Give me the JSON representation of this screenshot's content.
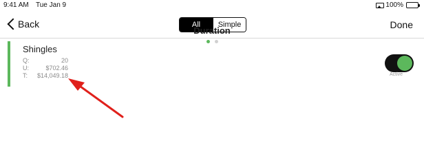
{
  "status_bar": {
    "time": "9:41 AM",
    "date": "Tue Jan 9",
    "battery_percent": "100%",
    "battery_level": 1.0,
    "battery_color": "#34c759"
  },
  "nav": {
    "back_label": "Back",
    "segments": [
      "All",
      "Simple"
    ],
    "selected_segment": "All",
    "done_label": "Done"
  },
  "item": {
    "title": "Shingles",
    "accent_color": "#5cb85c",
    "stats": [
      {
        "label": "Q:",
        "value": "20"
      },
      {
        "label": "U:",
        "value": "$702.46"
      },
      {
        "label": "T:",
        "value": "$14,049.18"
      }
    ],
    "center_title": "Duration",
    "page_count": 2,
    "current_page": 1,
    "toggle_on": true,
    "toggle_label": "Active"
  },
  "annotation": {
    "type": "arrow",
    "color": "#e0201b"
  },
  "icons": [
    "back-chevron-icon",
    "airplay-icon",
    "battery-icon"
  ]
}
